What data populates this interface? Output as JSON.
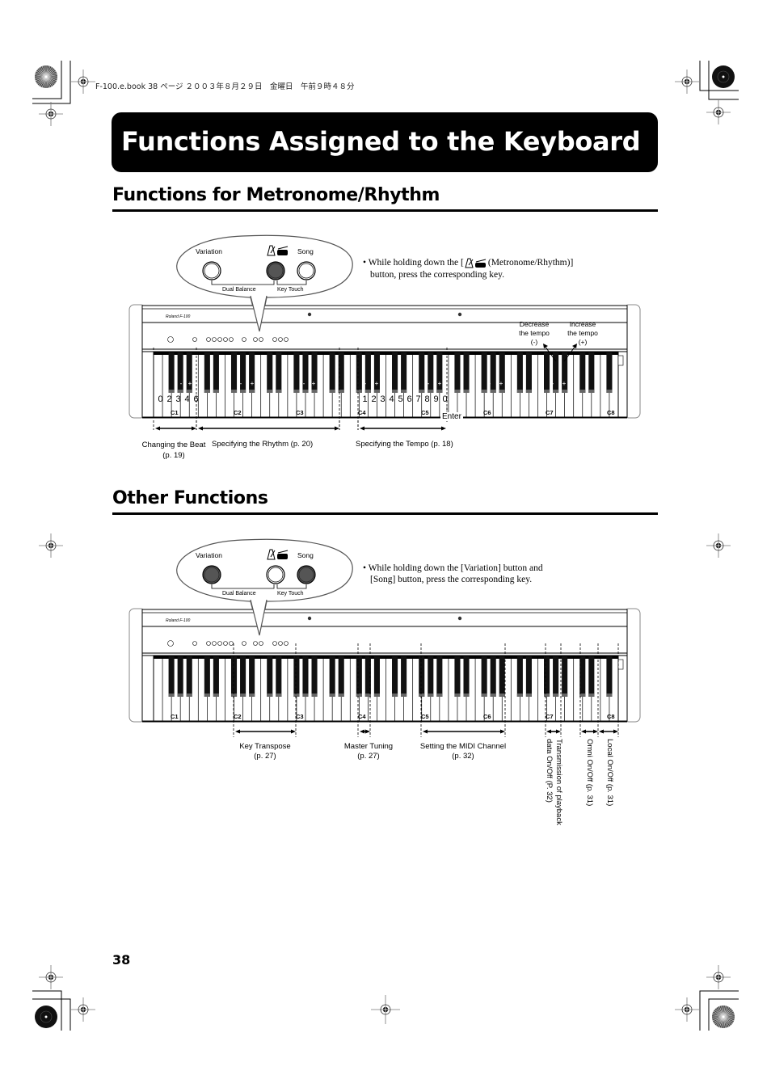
{
  "header": {
    "print_info": "F-100.e.book  38 ページ  ２００３年８月２９日　金曜日　午前９時４８分"
  },
  "page": {
    "title": "Functions Assigned to the Keyboard",
    "number": "38"
  },
  "sections": [
    {
      "title": "Functions for Metronome/Rhythm",
      "panel": {
        "left_label": "Variation",
        "right_label": "Song",
        "middle_icon": "metronome-rhythm-icon",
        "group_left": "Dual Balance",
        "group_right": "Key Touch",
        "pressed_buttons": [
          "metronome-rhythm"
        ]
      },
      "instruction_line1_pre": "• While holding down the [",
      "instruction_line1_post": "(Metronome/Rhythm)]",
      "instruction_line2": "button, press the corresponding key.",
      "tempo_labels": {
        "decrease": [
          "Decrease",
          "the tempo",
          "(-)"
        ],
        "increase": [
          "Increase",
          "the tempo",
          "(+)"
        ]
      },
      "beat_digits": [
        "0",
        "2",
        "3",
        "4",
        "6"
      ],
      "tempo_digits": [
        "1",
        "2",
        "3",
        "4",
        "5",
        "6",
        "7",
        "8",
        "9",
        "0"
      ],
      "enter_label": "Enter",
      "octave_labels": [
        "C1",
        "C2",
        "C3",
        "C4",
        "C5",
        "C6",
        "C7",
        "C8"
      ],
      "ranges": [
        {
          "label": "Changing the Beat",
          "ref": "(p. 19)"
        },
        {
          "label": "Specifying the Rhythm (p. 20)",
          "ref": ""
        },
        {
          "label": "Specifying the Tempo (p. 18)",
          "ref": ""
        }
      ]
    },
    {
      "title": "Other Functions",
      "panel": {
        "left_label": "Variation",
        "right_label": "Song",
        "middle_icon": "metronome-rhythm-icon",
        "group_left": "Dual Balance",
        "group_right": "Key Touch",
        "pressed_buttons": [
          "variation",
          "song"
        ]
      },
      "instruction_line1": "• While holding down the [Variation] button and",
      "instruction_line2": "[Song] button, press the corresponding key.",
      "octave_labels": [
        "C1",
        "C2",
        "C3",
        "C4",
        "C5",
        "C6",
        "C7",
        "C8"
      ],
      "ranges": [
        {
          "label": "Key Transpose",
          "ref": "(p. 27)"
        },
        {
          "label": "Master Tuning",
          "ref": "(p. 27)"
        },
        {
          "label": "Setting the MIDI Channel",
          "ref": "(p. 32)"
        }
      ],
      "vertical_ranges": [
        {
          "line1": "Transmission of playback",
          "line2": "data On/Off (P. 32)"
        },
        {
          "line1": "Omni On/Off (p. 31)",
          "line2": ""
        },
        {
          "line1": "Local On/Off (p. 31)",
          "line2": ""
        }
      ]
    }
  ],
  "piano_brand": "Roland F-100"
}
